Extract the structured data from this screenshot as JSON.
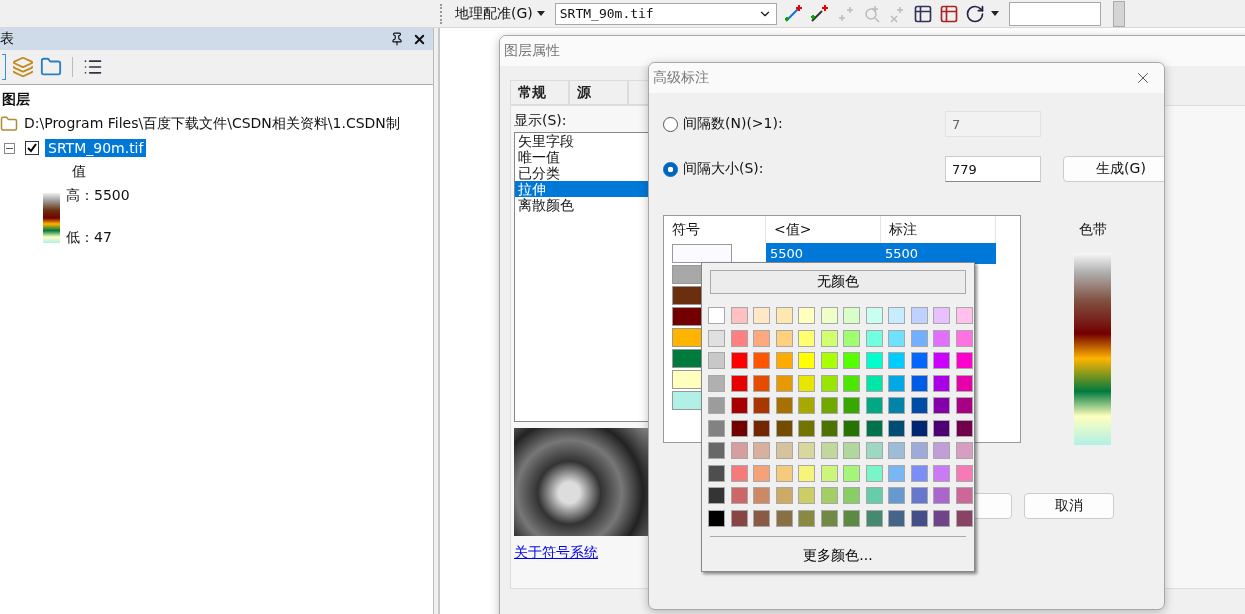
{
  "toolbar": {
    "menu": "地理配准(G)",
    "layer_select": "SRTM_90m.tif"
  },
  "toc": {
    "title": "表",
    "heading": "图层",
    "folder": "D:\\Program Files\\百度下载文件\\CSDN相关资料\\1.CSDN制",
    "layer": {
      "name": "SRTM_90m.tif",
      "checked": true,
      "expanded": true,
      "selected": true
    },
    "legend": {
      "field": "值",
      "high": "高：5500",
      "low": "低：47"
    }
  },
  "layer_properties": {
    "title": "图层属性",
    "tabs": [
      "常规",
      "源"
    ],
    "show_label": "显示(S):",
    "renderers": [
      {
        "label": "矢里字段",
        "selected": false
      },
      {
        "label": "唯一值",
        "selected": false
      },
      {
        "label": "已分类",
        "selected": false
      },
      {
        "label": "拉伸",
        "selected": true
      },
      {
        "label": "离散颜色",
        "selected": false
      }
    ],
    "link": "关于符号系统"
  },
  "advanced_labeling": {
    "title": "高级标注",
    "options": [
      {
        "label": "间隔数(N)(>1):",
        "selected": false,
        "value": "7",
        "disabled": true
      },
      {
        "label": "间隔大小(S):",
        "selected": true,
        "value": "779",
        "disabled": false
      }
    ],
    "generate_button": "生成(G)",
    "table": {
      "columns": [
        "符号",
        "<值>",
        "标注"
      ],
      "rows": [
        {
          "color": "#fbfbff",
          "value": "5500",
          "label": "5500",
          "selected": true
        },
        {
          "color": "#a8a8a8",
          "selected": false
        },
        {
          "color": "#6b2f10",
          "selected": false
        },
        {
          "color": "#730000",
          "selected": false
        },
        {
          "color": "#ffb400",
          "selected": false
        },
        {
          "color": "#007a3d",
          "selected": false
        },
        {
          "color": "#ffffbe",
          "selected": false
        },
        {
          "color": "#b0f0e6",
          "selected": false
        }
      ]
    },
    "ramp_label": "色带",
    "cancel_button": "取消"
  },
  "color_picker": {
    "no_color": "无颜色",
    "rows": [
      [
        {
          "color": "#ffffff"
        },
        {
          "color": "#ffc0c0"
        },
        {
          "color": "#ffe8c8"
        },
        {
          "color": "#ffe8b0"
        },
        {
          "color": "#ffffc0"
        },
        {
          "color": "#eeffc8"
        },
        {
          "color": "#d8ffc8"
        },
        {
          "color": "#c8fff0"
        },
        {
          "color": "#c8ecff"
        },
        {
          "color": "#c0d0ff"
        },
        {
          "color": "#e8c0ff"
        },
        {
          "color": "#ffc0ec"
        }
      ],
      [
        {
          "color": "#e0e0e0"
        },
        {
          "color": "#ff8080"
        },
        {
          "color": "#ffa880"
        },
        {
          "color": "#ffd080"
        },
        {
          "color": "#ffff70"
        },
        {
          "color": "#d0ff70"
        },
        {
          "color": "#a0ff70"
        },
        {
          "color": "#70ffe0"
        },
        {
          "color": "#70e0ff"
        },
        {
          "color": "#70b0ff"
        },
        {
          "color": "#e070ff"
        },
        {
          "color": "#ff70e0"
        }
      ],
      [
        {
          "color": "#c8c8c8"
        },
        {
          "color": "#ff0000"
        },
        {
          "color": "#ff5500"
        },
        {
          "color": "#ffaa00"
        },
        {
          "color": "#ffff00"
        },
        {
          "color": "#aaff00"
        },
        {
          "color": "#55ff00"
        },
        {
          "color": "#00ffcc"
        },
        {
          "color": "#00ccff"
        },
        {
          "color": "#0066ff"
        },
        {
          "color": "#cc00ff"
        },
        {
          "color": "#ff00cc"
        }
      ],
      [
        {
          "color": "#b0b0b0"
        },
        {
          "color": "#e60000"
        },
        {
          "color": "#e64c00"
        },
        {
          "color": "#e69900"
        },
        {
          "color": "#e6e600"
        },
        {
          "color": "#98e600"
        },
        {
          "color": "#4ce600"
        },
        {
          "color": "#00e6a9"
        },
        {
          "color": "#00a8e6"
        },
        {
          "color": "#005ce6"
        },
        {
          "color": "#a900e6"
        },
        {
          "color": "#e600a9"
        }
      ],
      [
        {
          "color": "#9c9c9c"
        },
        {
          "color": "#a80000"
        },
        {
          "color": "#a83800"
        },
        {
          "color": "#a87000"
        },
        {
          "color": "#a8a800"
        },
        {
          "color": "#70a800"
        },
        {
          "color": "#38a800"
        },
        {
          "color": "#00a884"
        },
        {
          "color": "#0084a8"
        },
        {
          "color": "#004da8"
        },
        {
          "color": "#8400a8"
        },
        {
          "color": "#a80084"
        }
      ],
      [
        {
          "color": "#828282"
        },
        {
          "color": "#730000"
        },
        {
          "color": "#732600"
        },
        {
          "color": "#734c00"
        },
        {
          "color": "#737300"
        },
        {
          "color": "#4c7300"
        },
        {
          "color": "#267300"
        },
        {
          "color": "#00734c"
        },
        {
          "color": "#004c73"
        },
        {
          "color": "#002673"
        },
        {
          "color": "#4c0073"
        },
        {
          "color": "#73004c"
        }
      ],
      [
        {
          "color": "#686868"
        },
        {
          "color": "#d79e9e"
        },
        {
          "color": "#d7b09e"
        },
        {
          "color": "#d7c29e"
        },
        {
          "color": "#d7d79e"
        },
        {
          "color": "#c2d79e"
        },
        {
          "color": "#b0d79e"
        },
        {
          "color": "#9ed7c2"
        },
        {
          "color": "#9ebbd7"
        },
        {
          "color": "#9eaad7"
        },
        {
          "color": "#c29ed7"
        },
        {
          "color": "#d79ec2"
        }
      ],
      [
        {
          "color": "#4e4e4e"
        },
        {
          "color": "#f57a7a"
        },
        {
          "color": "#f5a27a"
        },
        {
          "color": "#f5ca7a"
        },
        {
          "color": "#f5f57a"
        },
        {
          "color": "#cdf57a"
        },
        {
          "color": "#a5f57a"
        },
        {
          "color": "#7af5ca"
        },
        {
          "color": "#7ab6f5"
        },
        {
          "color": "#7a8ef5"
        },
        {
          "color": "#ca7af5"
        },
        {
          "color": "#f57ab6"
        }
      ],
      [
        {
          "color": "#343434"
        },
        {
          "color": "#cd6666"
        },
        {
          "color": "#cd8966"
        },
        {
          "color": "#cdaa66"
        },
        {
          "color": "#cdcd66"
        },
        {
          "color": "#a5cd66"
        },
        {
          "color": "#89cd66"
        },
        {
          "color": "#66cdab"
        },
        {
          "color": "#6699cd"
        },
        {
          "color": "#6677cd"
        },
        {
          "color": "#aa66cd"
        },
        {
          "color": "#cd6699"
        }
      ],
      [
        {
          "color": "#000000"
        },
        {
          "color": "#894444"
        },
        {
          "color": "#895a44"
        },
        {
          "color": "#897044"
        },
        {
          "color": "#898944"
        },
        {
          "color": "#708944"
        },
        {
          "color": "#5c8944"
        },
        {
          "color": "#448970"
        },
        {
          "color": "#446589"
        },
        {
          "color": "#444f89"
        },
        {
          "color": "#704489"
        },
        {
          "color": "#894465"
        }
      ]
    ],
    "more_colors": "更多颜色..."
  }
}
